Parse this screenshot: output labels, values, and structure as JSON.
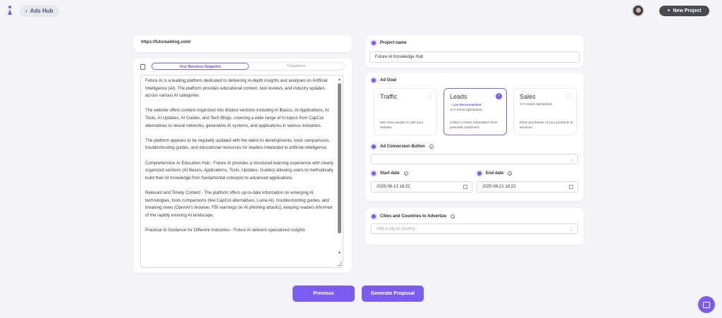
{
  "header": {
    "back_label": "Ads Hub",
    "new_project_label": "New Project"
  },
  "url": "https://futureaiblog.com/",
  "tabs": [
    "Your Business Snapshot",
    "Competitors"
  ],
  "snapshot_text": "Future AI is a leading platform dedicated to delivering in-depth insights and analyses on Artificial Intelligence (AI). The platform provides educational content, tool reviews, and industry updates across various AI categories.\n\nThe website offers content organized into distinct sections including AI Basics, AI Applications, AI Tools, AI Updates, AI Guides, and Tech Blogs, covering a wide range of AI topics from CapCut alternatives to neural networks, generative AI systems, and applications in various industries.\n\nThe platform appears to be regularly updated with the latest AI developments, tools comparisons, troubleshooting guides, and educational resources for readers interested in artificial intelligence.\n\nComprehensive AI Education Hub - Future AI provides a structured learning experience with clearly organized sections (AI Basics, Applications, Tools, Updates, Guides) allowing users to methodically build their AI knowledge from fundamental concepts to advanced applications.\n\nRelevant and Timely Content - The platform offers up-to-date information on emerging AI technologies, tools comparisons (like CapCut alternatives, Luma AI), troubleshooting guides, and breaking news (OpenAI's browser, FBI warnings on AI phishing attacks), keeping readers informed of the rapidly evolving AI landscape.\n\nPractical AI Guidance for Different Industries - Future AI delivers specialized insights",
  "project": {
    "label": "Project name",
    "value": "Future AI Knowledge Hub"
  },
  "ad_goal": {
    "label": "Ad Goal",
    "options": [
      {
        "title": "Traffic",
        "badge": "",
        "sub": "",
        "desc": "Get more people to visit your website."
      },
      {
        "title": "Leads",
        "badge": "✧ Leo Recommended",
        "sub": "⊘ AI Smart Optimization",
        "desc": "Collect contact information from potential customers."
      },
      {
        "title": "Sales",
        "badge": "",
        "sub": "⊘ AI Smart Optimization",
        "desc": "Drive purchases of your products or services."
      }
    ]
  },
  "conversion": {
    "label": "Ad Conversion Button",
    "value": ""
  },
  "dates": {
    "start_label": "Start date",
    "start_value": "2025-08-13 18:22",
    "end_label": "End date",
    "end_value": "2025-08-21 18:22"
  },
  "locations": {
    "label": "Cities and Countries to Advertize",
    "placeholder": "Add a city or country"
  },
  "footer": {
    "previous_label": "Previous",
    "generate_label": "Generate Proposal"
  },
  "colors": {
    "accent": "#7a5cf0",
    "dark_button": "#4a4a55"
  }
}
